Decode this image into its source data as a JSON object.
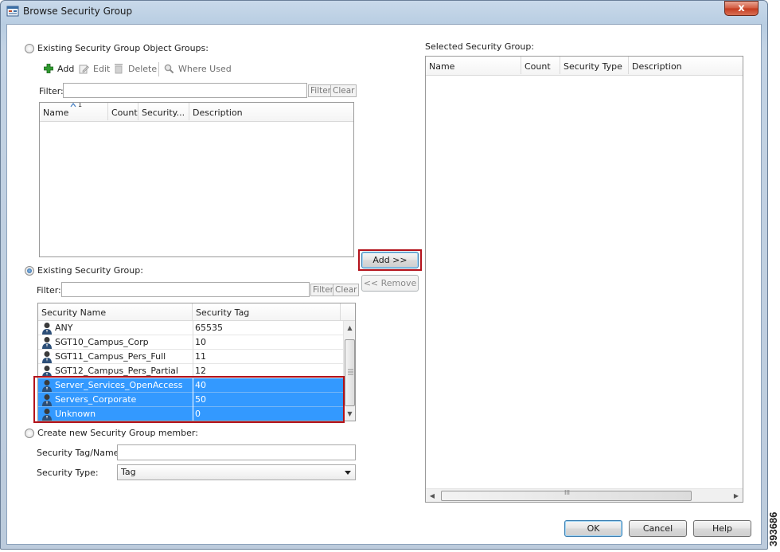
{
  "window": {
    "title": "Browse Security Group",
    "close_glyph": "x",
    "icon": "security-group-window-icon"
  },
  "object_groups": {
    "radio_label": "Existing Security Group Object Groups:",
    "selected": false,
    "toolbar": {
      "add_label": "Add",
      "edit_label": "Edit",
      "delete_label": "Delete",
      "where_used_label": "Where Used"
    },
    "filter_label": "Filter:",
    "filter_value": "",
    "filter_button": "Filter",
    "clear_button": "Clear",
    "sort_indicator": "1",
    "columns": [
      "Name",
      "Count",
      "Security...",
      "Description"
    ],
    "rows": []
  },
  "existing_group": {
    "radio_label": "Existing Security Group:",
    "selected": true,
    "filter_label": "Filter:",
    "filter_value": "",
    "filter_button": "Filter",
    "clear_button": "Clear",
    "columns": [
      "Security Name",
      "Security Tag"
    ],
    "rows": [
      {
        "name": "ANY",
        "tag": "65535",
        "selected": false
      },
      {
        "name": "SGT10_Campus_Corp",
        "tag": "10",
        "selected": false
      },
      {
        "name": "SGT11_Campus_Pers_Full",
        "tag": "11",
        "selected": false
      },
      {
        "name": "SGT12_Campus_Pers_Partial",
        "tag": "12",
        "selected": false
      },
      {
        "name": "Server_Services_OpenAccess",
        "tag": "40",
        "selected": true
      },
      {
        "name": "Servers_Corporate",
        "tag": "50",
        "selected": true
      },
      {
        "name": "Unknown",
        "tag": "0",
        "selected": true
      }
    ]
  },
  "new_member": {
    "radio_label": "Create new Security Group member:",
    "selected": false,
    "tag_name_label": "Security Tag/Name:",
    "tag_name_value": "",
    "type_label": "Security Type:",
    "type_value": "Tag"
  },
  "transfer": {
    "add_label": "Add >>",
    "remove_label": "<< Remove"
  },
  "selected_groups": {
    "title": "Selected Security Group:",
    "columns": [
      "Name",
      "Count",
      "Security Type",
      "Description"
    ],
    "rows": [],
    "hscroll_grip": "III"
  },
  "footer": {
    "ok_label": "OK",
    "cancel_label": "Cancel",
    "help_label": "Help"
  },
  "figure_id": "393686",
  "colors": {
    "selection": "#3399ff",
    "highlight_box": "#b3121b",
    "title_bar": "#c9d9ea"
  }
}
